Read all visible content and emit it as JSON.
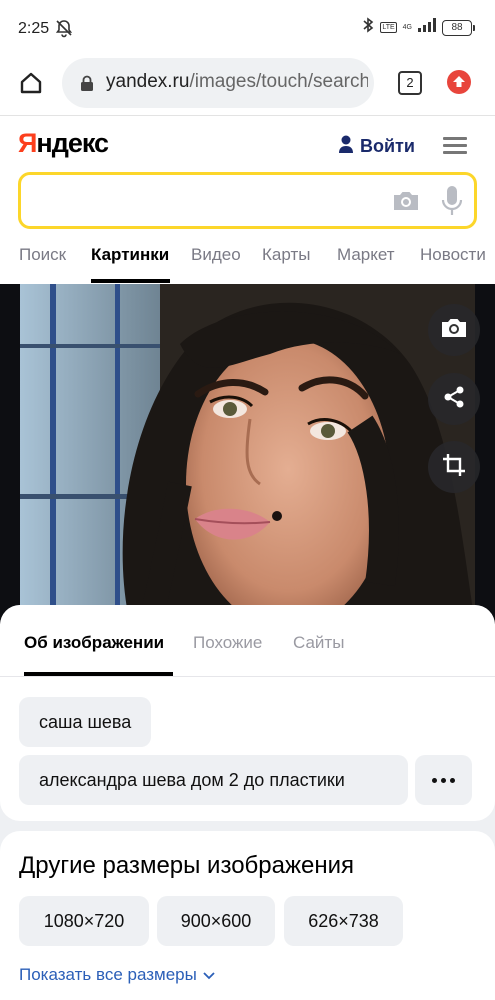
{
  "status_bar": {
    "time": "2:25",
    "lte": "LTE",
    "network": "4G",
    "battery": "88"
  },
  "browser": {
    "url_domain": "yandex.ru",
    "url_path": "/images/touch/search",
    "tab_count": "2"
  },
  "header": {
    "logo_first": "Я",
    "logo_rest": "ндекс",
    "login_label": "Войти"
  },
  "search": {
    "value": ""
  },
  "service_tabs": [
    "Поиск",
    "Картинки",
    "Видео",
    "Карты",
    "Маркет",
    "Новости"
  ],
  "service_tab_active": "Картинки",
  "info_tabs": [
    "Об изображении",
    "Похожие",
    "Сайты"
  ],
  "info_tab_active": "Об изображении",
  "tags": [
    "саша шева",
    "александра шева дом 2 до пластики"
  ],
  "sizes": {
    "title": "Другие размеры изображения",
    "items": [
      "1080×720",
      "900×600",
      "626×738"
    ],
    "show_all": "Показать все размеры"
  },
  "colors": {
    "accent_yellow": "#fcd62a",
    "logo_red": "#fc3f1d",
    "link_blue": "#2b5fb8",
    "login_navy": "#1a2a6b"
  },
  "icons": [
    "home-icon",
    "lock-icon",
    "update-icon",
    "user-icon",
    "menu-icon",
    "camera-icon",
    "mic-icon",
    "share-icon",
    "crop-icon",
    "more-icon",
    "chevron-down-icon"
  ]
}
